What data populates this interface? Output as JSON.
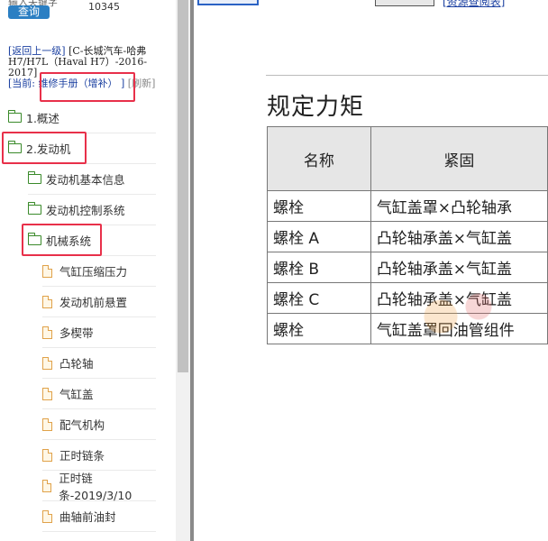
{
  "search": {
    "hint": "输入关键字",
    "count": "10345",
    "button_label": "查询"
  },
  "breadcrumb": {
    "back_label": "[返回上一级]",
    "path": "[C-长城汽车-哈弗H7/H7L（Haval H7）-2016-2017]",
    "current_label": "[当前:",
    "current_value": "维修手册（增补）",
    "current_close": "]",
    "refresh_label": "[刷新]"
  },
  "tree": [
    {
      "label": "1.概述",
      "kind": "folder",
      "level": 0,
      "highlighted": false
    },
    {
      "label": "2.发动机",
      "kind": "folder-open",
      "level": 0,
      "highlighted": true
    },
    {
      "label": "发动机基本信息",
      "kind": "folder",
      "level": 1,
      "highlighted": false
    },
    {
      "label": "发动机控制系统",
      "kind": "folder",
      "level": 1,
      "highlighted": false
    },
    {
      "label": "机械系统",
      "kind": "folder-open",
      "level": 1,
      "highlighted": true
    },
    {
      "label": "气缸压缩压力",
      "kind": "doc",
      "level": 2,
      "highlighted": false
    },
    {
      "label": "发动机前悬置",
      "kind": "doc",
      "level": 2,
      "highlighted": false
    },
    {
      "label": "多楔带",
      "kind": "doc",
      "level": 2,
      "highlighted": false
    },
    {
      "label": "凸轮轴",
      "kind": "doc",
      "level": 2,
      "highlighted": false
    },
    {
      "label": "气缸盖",
      "kind": "doc",
      "level": 2,
      "highlighted": false
    },
    {
      "label": "配气机构",
      "kind": "doc",
      "level": 2,
      "highlighted": false
    },
    {
      "label": "正时链条",
      "kind": "doc",
      "level": 2,
      "highlighted": false
    },
    {
      "label": "正时链条-2019/3/10",
      "kind": "doc",
      "level": 2,
      "highlighted": false
    },
    {
      "label": "曲轴前油封",
      "kind": "doc",
      "level": 2,
      "highlighted": false
    }
  ],
  "content": {
    "top_link": "[资源查阅表]",
    "title": "规定力矩",
    "table": {
      "headers": [
        "名称",
        "紧固"
      ],
      "rows": [
        [
          "螺栓",
          "气缸盖罩×凸轮轴承"
        ],
        [
          "螺栓 A",
          "凸轮轴承盖×气缸盖"
        ],
        [
          "螺栓 B",
          "凸轮轴承盖×气缸盖"
        ],
        [
          "螺栓 C",
          "凸轮轴承盖×气缸盖"
        ],
        [
          "螺栓",
          "气缸盖罩回油管组件"
        ]
      ]
    }
  },
  "colors": {
    "highlight": "#e8304a",
    "folder": "#3a8a2a",
    "doc": "#e0a24a",
    "link": "#1a3fa0",
    "button": "#2b7fc3"
  }
}
